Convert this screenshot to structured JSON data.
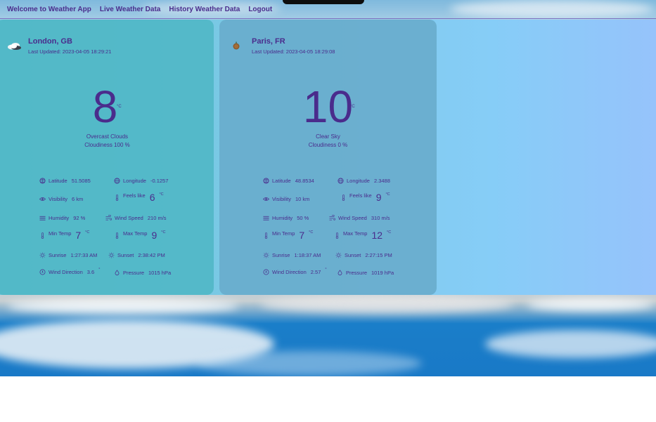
{
  "nav": {
    "home": "Welcome to Weather App",
    "live": "Live Weather Data",
    "history": "History Weather Data",
    "logout": "Logout"
  },
  "cards": {
    "london": {
      "city": "London, GB",
      "updated": "Last Updated: 2023-04-05 18:29:21",
      "icon": "overcast-clouds-icon",
      "temp": "8",
      "unit": "°C",
      "desc": "Overcast Clouds",
      "cloudiness": "Cloudiness 100 %",
      "latitude_label": "Latitude",
      "latitude": "51.5085",
      "longitude_label": "Longitude",
      "longitude": "-0.1257",
      "visibility_label": "Visibility",
      "visibility": "6 km",
      "feels_label": "Feels like",
      "feels": "6",
      "humidity_label": "Humidity",
      "humidity": "92 %",
      "wind_label": "Wind Speed",
      "wind": "210 m/s",
      "min_label": "Min Temp",
      "min": "7",
      "max_label": "Max Temp",
      "max": "9",
      "sunrise_label": "Sunrise",
      "sunrise": "1:27:33 AM",
      "sunset_label": "Sunset",
      "sunset": "2:38:42 PM",
      "dir_label": "Wind Direction",
      "dir": "3.6",
      "dir_unit": "°",
      "pressure_label": "Pressure",
      "pressure": "1015 hPa"
    },
    "paris": {
      "city": "Paris, FR",
      "updated": "Last Updated: 2023-04-05 18:29:08",
      "icon": "clear-sky-icon",
      "temp": "10",
      "unit": "°C",
      "desc": "Clear Sky",
      "cloudiness": "Cloudiness 0 %",
      "latitude_label": "Latitude",
      "latitude": "48.8534",
      "longitude_label": "Longitude",
      "longitude": "2.3488",
      "visibility_label": "Visibility",
      "visibility": "10 km",
      "feels_label": "Feels like",
      "feels": "9",
      "humidity_label": "Humidity",
      "humidity": "50 %",
      "wind_label": "Wind Speed",
      "wind": "310 m/s",
      "min_label": "Min Temp",
      "min": "7",
      "max_label": "Max Temp",
      "max": "12",
      "sunrise_label": "Sunrise",
      "sunrise": "1:18:37 AM",
      "sunset_label": "Sunset",
      "sunset": "2:27:15 PM",
      "dir_label": "Wind Direction",
      "dir": "2.57",
      "dir_unit": "°",
      "pressure_label": "Pressure",
      "pressure": "1019 hPa"
    }
  },
  "colors": {
    "accent": "#4a2c8c",
    "card_london": "#4db6c4",
    "card_paris": "#68accc"
  }
}
